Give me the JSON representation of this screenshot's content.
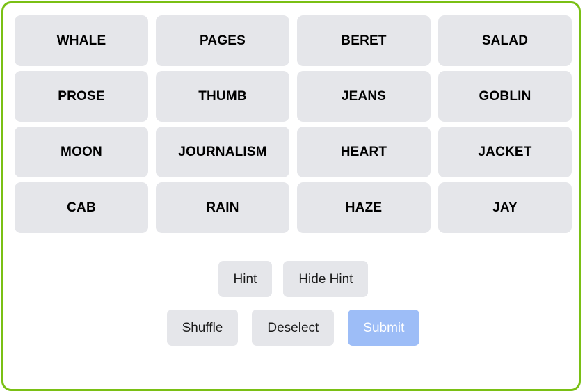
{
  "theme": {
    "frame_border_color": "#7ac014",
    "tile_background": "#e5e6ea",
    "tile_text_color": "#000000",
    "page_background": "#ffffff",
    "submit_background": "#9dbdf7",
    "submit_text_color": "#ffffff"
  },
  "grid": {
    "columns": 4,
    "rows": 4,
    "tiles": [
      {
        "label": "WHALE"
      },
      {
        "label": "PAGES"
      },
      {
        "label": "BERET"
      },
      {
        "label": "SALAD"
      },
      {
        "label": "PROSE"
      },
      {
        "label": "THUMB"
      },
      {
        "label": "JEANS"
      },
      {
        "label": "GOBLIN"
      },
      {
        "label": "MOON"
      },
      {
        "label": "JOURNALISM"
      },
      {
        "label": "HEART"
      },
      {
        "label": "JACKET"
      },
      {
        "label": "CAB"
      },
      {
        "label": "RAIN"
      },
      {
        "label": "HAZE"
      },
      {
        "label": "JAY"
      }
    ]
  },
  "controls": {
    "hint_row": [
      {
        "label": "Hint",
        "style": "default"
      },
      {
        "label": "Hide Hint",
        "style": "default"
      }
    ],
    "action_row": [
      {
        "label": "Shuffle",
        "style": "default"
      },
      {
        "label": "Deselect",
        "style": "default"
      },
      {
        "label": "Submit",
        "style": "primary"
      }
    ]
  }
}
